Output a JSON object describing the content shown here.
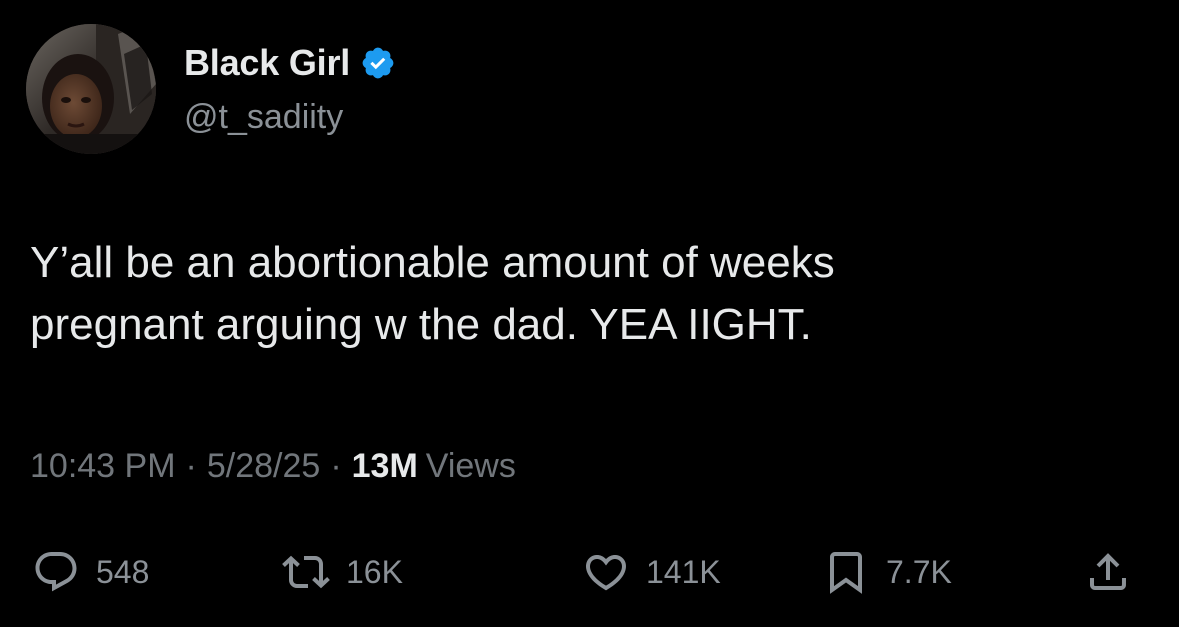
{
  "author": {
    "display_name": "Black Girl",
    "handle": "@t_sadiity",
    "verified_icon": "verified-badge-icon"
  },
  "tweet": {
    "text_lines": [
      "Y’all be an abortionable amount of weeks",
      "pregnant arguing w the dad. YEA IIGHT."
    ]
  },
  "meta": {
    "time": "10:43 PM",
    "separator": "·",
    "date": "5/28/25",
    "views_count": "13M",
    "views_label": "Views"
  },
  "actions": {
    "reply": {
      "icon": "reply-icon",
      "count": "548"
    },
    "retweet": {
      "icon": "retweet-icon",
      "count": "16K"
    },
    "like": {
      "icon": "heart-icon",
      "count": "141K"
    },
    "bookmark": {
      "icon": "bookmark-icon",
      "count": "7.7K"
    },
    "share": {
      "icon": "share-icon"
    }
  },
  "colors": {
    "background": "#000000",
    "primary_text": "#e7e9ea",
    "secondary_text": "#71767b",
    "verified_blue": "#1d9bf0"
  }
}
